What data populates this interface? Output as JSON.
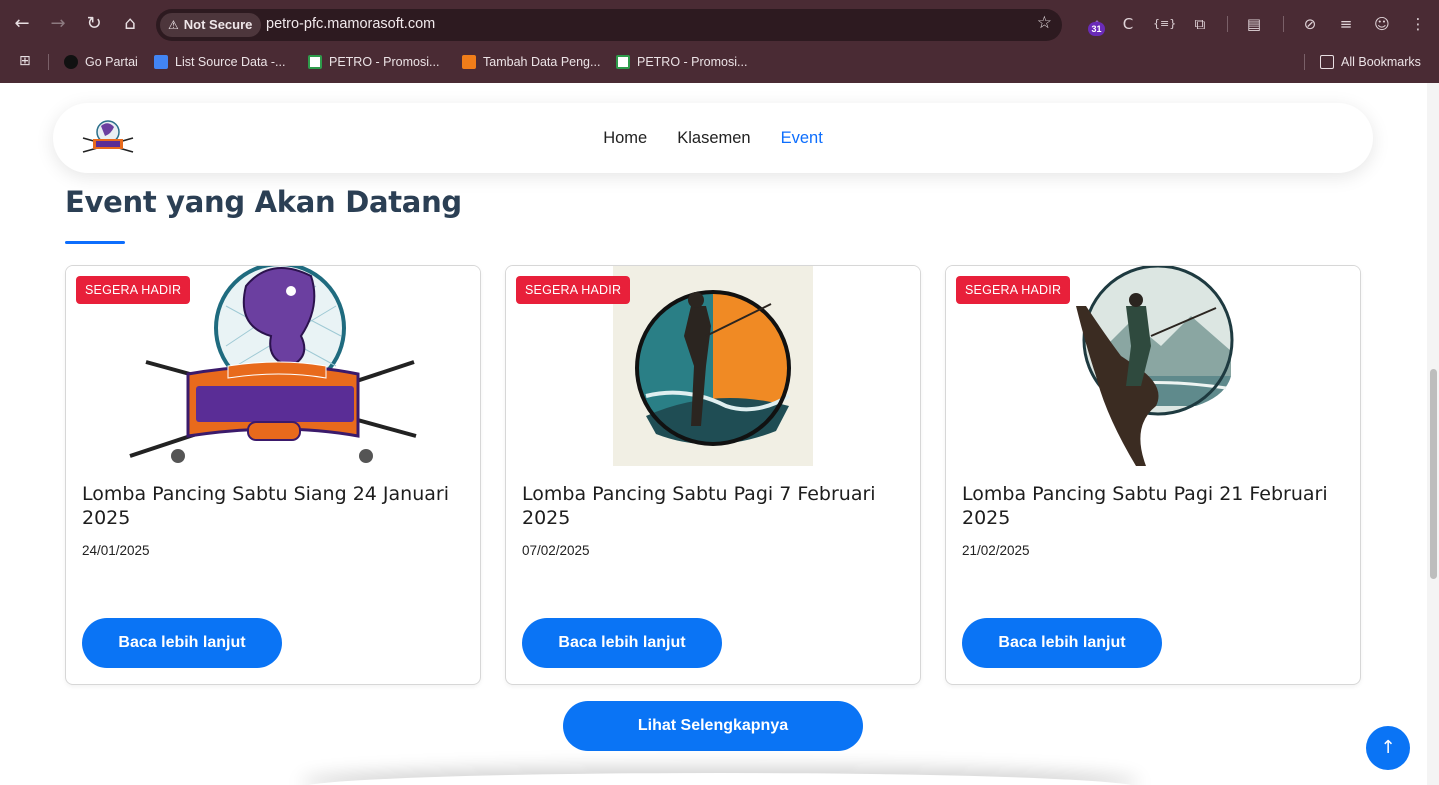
{
  "browser": {
    "security_label": "Not Secure",
    "url": "petro-pfc.mamorasoft.com",
    "extension_badge": "31",
    "bookmarks": [
      {
        "label": "Go Partai",
        "icon": "triangle-icon",
        "color": "#111111"
      },
      {
        "label": "List Source Data -...",
        "icon": "docs-icon",
        "color": "#4285f4"
      },
      {
        "label": "PETRO - Promosi...",
        "icon": "petro-favicon-icon",
        "color": "#2e9b4b"
      },
      {
        "label": "Tambah Data Peng...",
        "icon": "cc-favicon-icon",
        "color": "#ef7d1a"
      },
      {
        "label": "PETRO - Promosi...",
        "icon": "petro-favicon-icon",
        "color": "#2e9b4b"
      }
    ],
    "all_bookmarks_label": "All Bookmarks"
  },
  "navbar": {
    "links": [
      {
        "label": "Home",
        "active": false
      },
      {
        "label": "Klasemen",
        "active": false
      },
      {
        "label": "Event",
        "active": true
      }
    ]
  },
  "section": {
    "title": "Event yang Akan Datang"
  },
  "events": [
    {
      "badge": "SEGERA HADIR",
      "title": "Lomba Pancing Sabtu Siang 24 Januari 2025",
      "date": "24/01/2025",
      "button": "Baca lebih lanjut",
      "image": "petrokimia-fishing-club-logo"
    },
    {
      "badge": "SEGERA HADIR",
      "title": "Lomba Pancing Sabtu Pagi 7 Februari 2025",
      "date": "07/02/2025",
      "button": "Baca lebih lanjut",
      "image": "fisherman-circle-illustration"
    },
    {
      "badge": "SEGERA HADIR",
      "title": "Lomba Pancing Sabtu Pagi 21 Februari 2025",
      "date": "21/02/2025",
      "button": "Baca lebih lanjut",
      "image": "fisherman-lake-illustration"
    }
  ],
  "more_button": "Lihat Selengkapnya",
  "colors": {
    "accent": "#0a74f5",
    "badge": "#e8203a",
    "title": "#2b3f54",
    "chrome": "#4a2b34"
  }
}
